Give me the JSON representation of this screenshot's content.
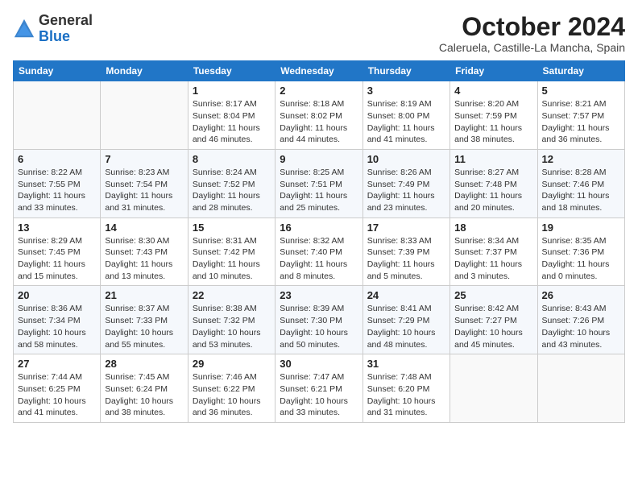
{
  "header": {
    "logo_general": "General",
    "logo_blue": "Blue",
    "month": "October 2024",
    "location": "Caleruela, Castille-La Mancha, Spain"
  },
  "days_of_week": [
    "Sunday",
    "Monday",
    "Tuesday",
    "Wednesday",
    "Thursday",
    "Friday",
    "Saturday"
  ],
  "weeks": [
    [
      {
        "day": "",
        "info": ""
      },
      {
        "day": "",
        "info": ""
      },
      {
        "day": "1",
        "info": "Sunrise: 8:17 AM\nSunset: 8:04 PM\nDaylight: 11 hours and 46 minutes."
      },
      {
        "day": "2",
        "info": "Sunrise: 8:18 AM\nSunset: 8:02 PM\nDaylight: 11 hours and 44 minutes."
      },
      {
        "day": "3",
        "info": "Sunrise: 8:19 AM\nSunset: 8:00 PM\nDaylight: 11 hours and 41 minutes."
      },
      {
        "day": "4",
        "info": "Sunrise: 8:20 AM\nSunset: 7:59 PM\nDaylight: 11 hours and 38 minutes."
      },
      {
        "day": "5",
        "info": "Sunrise: 8:21 AM\nSunset: 7:57 PM\nDaylight: 11 hours and 36 minutes."
      }
    ],
    [
      {
        "day": "6",
        "info": "Sunrise: 8:22 AM\nSunset: 7:55 PM\nDaylight: 11 hours and 33 minutes."
      },
      {
        "day": "7",
        "info": "Sunrise: 8:23 AM\nSunset: 7:54 PM\nDaylight: 11 hours and 31 minutes."
      },
      {
        "day": "8",
        "info": "Sunrise: 8:24 AM\nSunset: 7:52 PM\nDaylight: 11 hours and 28 minutes."
      },
      {
        "day": "9",
        "info": "Sunrise: 8:25 AM\nSunset: 7:51 PM\nDaylight: 11 hours and 25 minutes."
      },
      {
        "day": "10",
        "info": "Sunrise: 8:26 AM\nSunset: 7:49 PM\nDaylight: 11 hours and 23 minutes."
      },
      {
        "day": "11",
        "info": "Sunrise: 8:27 AM\nSunset: 7:48 PM\nDaylight: 11 hours and 20 minutes."
      },
      {
        "day": "12",
        "info": "Sunrise: 8:28 AM\nSunset: 7:46 PM\nDaylight: 11 hours and 18 minutes."
      }
    ],
    [
      {
        "day": "13",
        "info": "Sunrise: 8:29 AM\nSunset: 7:45 PM\nDaylight: 11 hours and 15 minutes."
      },
      {
        "day": "14",
        "info": "Sunrise: 8:30 AM\nSunset: 7:43 PM\nDaylight: 11 hours and 13 minutes."
      },
      {
        "day": "15",
        "info": "Sunrise: 8:31 AM\nSunset: 7:42 PM\nDaylight: 11 hours and 10 minutes."
      },
      {
        "day": "16",
        "info": "Sunrise: 8:32 AM\nSunset: 7:40 PM\nDaylight: 11 hours and 8 minutes."
      },
      {
        "day": "17",
        "info": "Sunrise: 8:33 AM\nSunset: 7:39 PM\nDaylight: 11 hours and 5 minutes."
      },
      {
        "day": "18",
        "info": "Sunrise: 8:34 AM\nSunset: 7:37 PM\nDaylight: 11 hours and 3 minutes."
      },
      {
        "day": "19",
        "info": "Sunrise: 8:35 AM\nSunset: 7:36 PM\nDaylight: 11 hours and 0 minutes."
      }
    ],
    [
      {
        "day": "20",
        "info": "Sunrise: 8:36 AM\nSunset: 7:34 PM\nDaylight: 10 hours and 58 minutes."
      },
      {
        "day": "21",
        "info": "Sunrise: 8:37 AM\nSunset: 7:33 PM\nDaylight: 10 hours and 55 minutes."
      },
      {
        "day": "22",
        "info": "Sunrise: 8:38 AM\nSunset: 7:32 PM\nDaylight: 10 hours and 53 minutes."
      },
      {
        "day": "23",
        "info": "Sunrise: 8:39 AM\nSunset: 7:30 PM\nDaylight: 10 hours and 50 minutes."
      },
      {
        "day": "24",
        "info": "Sunrise: 8:41 AM\nSunset: 7:29 PM\nDaylight: 10 hours and 48 minutes."
      },
      {
        "day": "25",
        "info": "Sunrise: 8:42 AM\nSunset: 7:27 PM\nDaylight: 10 hours and 45 minutes."
      },
      {
        "day": "26",
        "info": "Sunrise: 8:43 AM\nSunset: 7:26 PM\nDaylight: 10 hours and 43 minutes."
      }
    ],
    [
      {
        "day": "27",
        "info": "Sunrise: 7:44 AM\nSunset: 6:25 PM\nDaylight: 10 hours and 41 minutes."
      },
      {
        "day": "28",
        "info": "Sunrise: 7:45 AM\nSunset: 6:24 PM\nDaylight: 10 hours and 38 minutes."
      },
      {
        "day": "29",
        "info": "Sunrise: 7:46 AM\nSunset: 6:22 PM\nDaylight: 10 hours and 36 minutes."
      },
      {
        "day": "30",
        "info": "Sunrise: 7:47 AM\nSunset: 6:21 PM\nDaylight: 10 hours and 33 minutes."
      },
      {
        "day": "31",
        "info": "Sunrise: 7:48 AM\nSunset: 6:20 PM\nDaylight: 10 hours and 31 minutes."
      },
      {
        "day": "",
        "info": ""
      },
      {
        "day": "",
        "info": ""
      }
    ]
  ]
}
